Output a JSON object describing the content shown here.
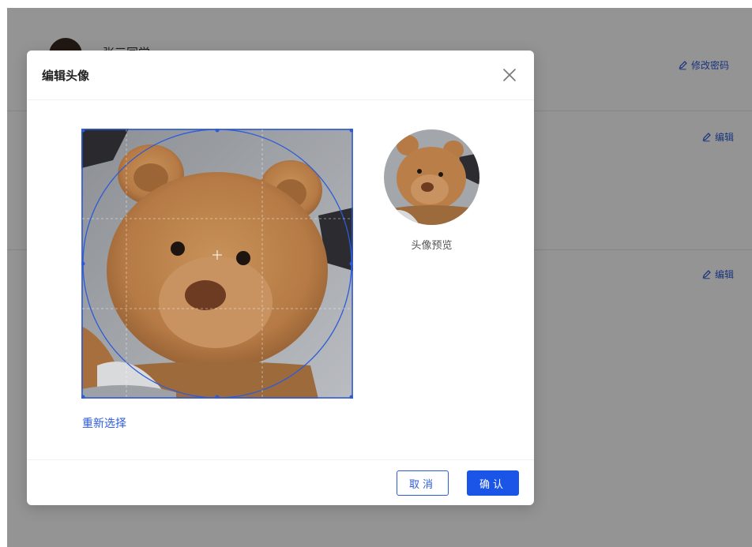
{
  "background": {
    "username": "张三同学",
    "change_password_label": "修改密码",
    "edit_label_1": "编辑",
    "edit_label_2": "编辑"
  },
  "modal": {
    "title": "编辑头像",
    "preview_label": "头像预览",
    "reselect_label": "重新选择",
    "cancel_label": "取消",
    "confirm_label": "确认"
  },
  "icons": {
    "close": "close-icon",
    "edit": "pencil-icon"
  },
  "colors": {
    "accent": "#1a55e8",
    "link": "#2d5bd9",
    "overlay": "rgba(0,0,0,0.42)"
  }
}
